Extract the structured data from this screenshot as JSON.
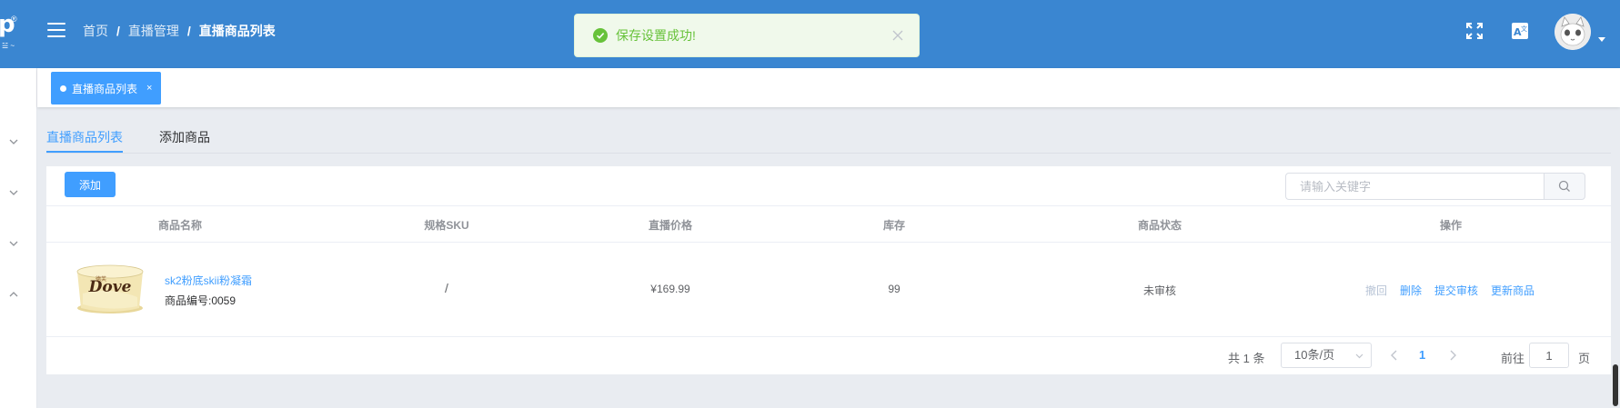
{
  "logo": {
    "letter": "p",
    "reg": "®",
    "small": "☱ ~"
  },
  "header": {
    "breadcrumb": [
      "首页",
      "直播管理",
      "直播商品列表"
    ],
    "separator": "/"
  },
  "toast": {
    "message": "保存设置成功!",
    "type": "success"
  },
  "tagsbar": {
    "active_tag": "直播商品列表",
    "close": "×"
  },
  "tabs": [
    {
      "label": "直播商品列表",
      "active": true
    },
    {
      "label": "添加商品",
      "active": false
    }
  ],
  "toolbar": {
    "add_label": "添加",
    "search_placeholder": "请输入关键字"
  },
  "table": {
    "columns": [
      "商品名称",
      "规格SKU",
      "直播价格",
      "库存",
      "商品状态",
      "操作"
    ],
    "rows": [
      {
        "name": "sk2粉底skii粉凝霜",
        "code": "商品编号:0059",
        "sku": "/",
        "price": "¥169.99",
        "stock": "99",
        "status": "未审核",
        "actions": [
          "撤回",
          "删除",
          "提交审核",
          "更新商品"
        ]
      }
    ]
  },
  "pagination": {
    "total_text": "共 1 条",
    "page_size": "10条/页",
    "current_page": "1",
    "goto_label": "前往",
    "goto_value": "1",
    "page_suffix": "页"
  },
  "colors": {
    "header": "#3a86d1",
    "primary": "#409eff",
    "success": "#67c23a"
  }
}
